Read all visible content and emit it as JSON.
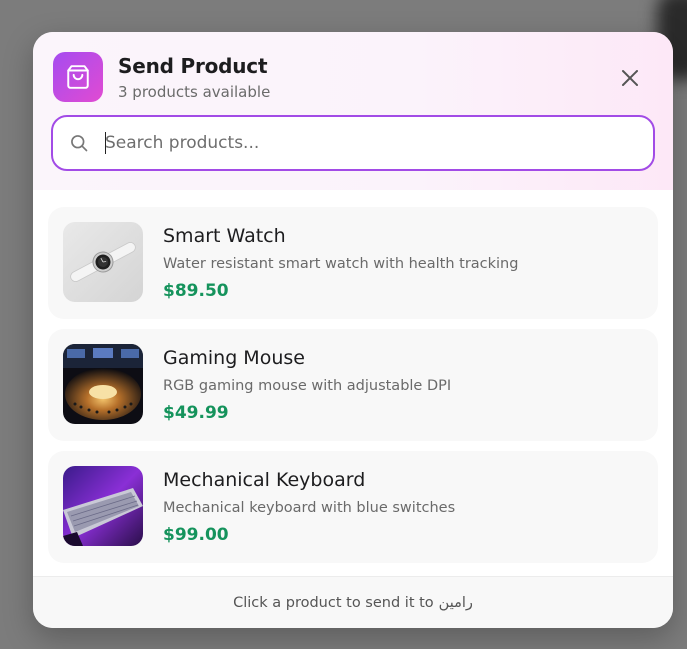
{
  "header": {
    "title": "Send Product",
    "subtitle": "3 products available",
    "icon": "shopping-bag-icon",
    "accent_gradient": [
      "#a54cf0",
      "#e14bd2"
    ]
  },
  "search": {
    "placeholder": "Search products...",
    "value": "",
    "border_color": "#a24be6"
  },
  "products": [
    {
      "name": "Smart Watch",
      "description": "Water resistant smart watch with health tracking",
      "price": "$89.50",
      "image": "smart-watch-image"
    },
    {
      "name": "Gaming Mouse",
      "description": "RGB gaming mouse with adjustable DPI",
      "price": "$49.99",
      "image": "gaming-mouse-image"
    },
    {
      "name": "Mechanical Keyboard",
      "description": "Mechanical keyboard with blue switches",
      "price": "$99.00",
      "image": "mechanical-keyboard-image"
    }
  ],
  "footer": {
    "text": "Click a product to send it to",
    "recipient": "رامین"
  },
  "colors": {
    "price": "#15935c",
    "card_bg": "#f8f8f8"
  }
}
